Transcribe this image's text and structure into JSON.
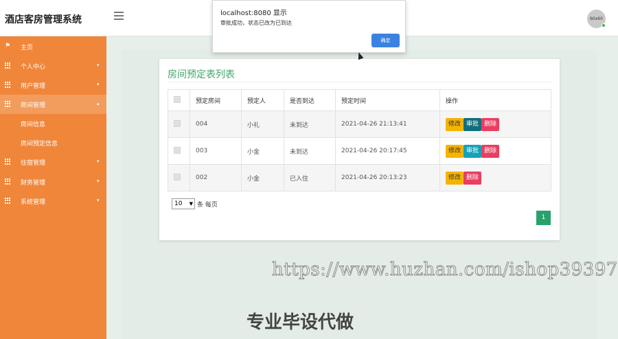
{
  "header": {
    "app_title": "酒店客房管理系统",
    "avatar_text": "60x60"
  },
  "sidebar": {
    "items": [
      {
        "label": "主页",
        "icon": "flag-icon"
      },
      {
        "label": "个人中心",
        "icon": "grid-icon"
      },
      {
        "label": "用户管理",
        "icon": "grid-icon"
      },
      {
        "label": "房间管理",
        "icon": "grid-icon",
        "expanded": true
      },
      {
        "label": "住宿管理",
        "icon": "grid-icon"
      },
      {
        "label": "财务管理",
        "icon": "grid-icon"
      },
      {
        "label": "系统管理",
        "icon": "grid-icon"
      }
    ],
    "subitems": [
      {
        "label": "房间信息"
      },
      {
        "label": "房间预定信息"
      }
    ]
  },
  "main": {
    "title": "房间预定表列表",
    "columns": [
      "预定房间",
      "预定人",
      "是否到达",
      "预定时间",
      "操作"
    ],
    "rows": [
      {
        "room": "004",
        "person": "小礼",
        "status": "未到达",
        "time": "2021-04-26 21:13:41"
      },
      {
        "room": "003",
        "person": "小金",
        "status": "未到达",
        "time": "2021-04-26 20:17:45"
      },
      {
        "room": "002",
        "person": "小金",
        "status": "已入住",
        "time": "2021-04-26 20:13:23"
      }
    ],
    "actions": {
      "edit": "修改",
      "approve": "审批",
      "delete": "删除"
    },
    "pager": {
      "page_size": "10",
      "per_page_label": "条 每页",
      "current_page": "1"
    }
  },
  "dialog": {
    "title": "localhost:8080 显示",
    "message": "审批成功，状态已改为已到达",
    "ok": "确定"
  },
  "watermark": {
    "url": "https://www.huzhan.com/ishop39397",
    "promo": "专业毕设代做"
  },
  "colors": {
    "sidebar": "#f0863a",
    "accent": "#3fa86a",
    "approve": "#17a2b8",
    "delete": "#ea3e5f",
    "edit": "#f5b400"
  }
}
